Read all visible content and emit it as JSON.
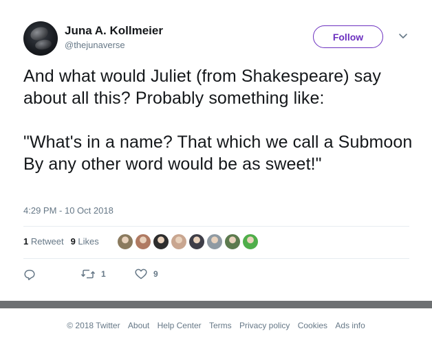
{
  "author": {
    "name": "Juna A. Kollmeier",
    "handle": "@thejunaverse"
  },
  "follow_label": "Follow",
  "tweet_text": "And what would Juliet (from Shakespeare) say about all this? Probably something like:\n\n\"What's in a name? That which we call a Submoon\nBy any other word would be as sweet!\"",
  "timestamp": "4:29 PM - 10 Oct 2018",
  "stats": {
    "retweets_count": "1",
    "retweets_label": "Retweet",
    "likes_count": "9",
    "likes_label": "Likes"
  },
  "likers": [
    {
      "icon": "avatar",
      "color": "#8a7a5e"
    },
    {
      "icon": "avatar",
      "color": "#b07a62"
    },
    {
      "icon": "avatar",
      "color": "#2d2d2d"
    },
    {
      "icon": "avatar",
      "color": "#c9a690"
    },
    {
      "icon": "avatar",
      "color": "#3e3e48"
    },
    {
      "icon": "avatar",
      "color": "#8f9aa3"
    },
    {
      "icon": "avatar",
      "color": "#5c7a4e"
    },
    {
      "icon": "avatar",
      "color": "#4fae4a"
    }
  ],
  "actions": {
    "reply_icon": "reply-icon",
    "retweet_count": "1",
    "like_count": "9"
  },
  "footer": {
    "copyright": "© 2018 Twitter",
    "links": [
      "About",
      "Help Center",
      "Terms",
      "Privacy policy",
      "Cookies",
      "Ads info"
    ]
  },
  "colors": {
    "accent": "#6b2fbf",
    "muted": "#657786",
    "text": "#14171a"
  }
}
